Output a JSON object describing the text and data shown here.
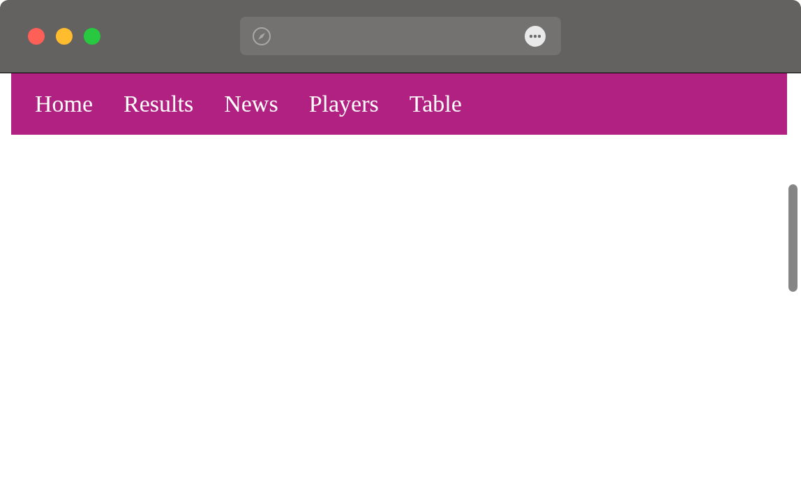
{
  "nav": {
    "items": [
      {
        "label": "Home"
      },
      {
        "label": "Results"
      },
      {
        "label": "News"
      },
      {
        "label": "Players"
      },
      {
        "label": "Table"
      }
    ]
  }
}
